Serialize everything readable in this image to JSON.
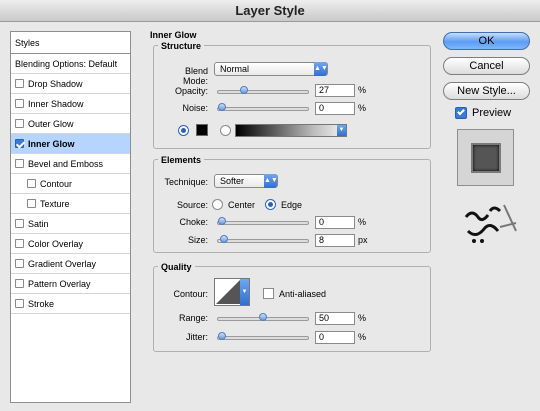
{
  "window": {
    "title": "Layer Style"
  },
  "sidebar": {
    "header": "Styles",
    "items": [
      {
        "label": "Blending Options: Default",
        "checkbox": false,
        "checked": false,
        "selected": false
      },
      {
        "label": "Drop Shadow",
        "checkbox": true,
        "checked": false,
        "selected": false
      },
      {
        "label": "Inner Shadow",
        "checkbox": true,
        "checked": false,
        "selected": false
      },
      {
        "label": "Outer Glow",
        "checkbox": true,
        "checked": false,
        "selected": false
      },
      {
        "label": "Inner Glow",
        "checkbox": true,
        "checked": true,
        "selected": true
      },
      {
        "label": "Bevel and Emboss",
        "checkbox": true,
        "checked": false,
        "selected": false
      },
      {
        "label": "Contour",
        "checkbox": true,
        "checked": false,
        "selected": false
      },
      {
        "label": "Texture",
        "checkbox": true,
        "checked": false,
        "selected": false
      },
      {
        "label": "Satin",
        "checkbox": true,
        "checked": false,
        "selected": false
      },
      {
        "label": "Color Overlay",
        "checkbox": true,
        "checked": false,
        "selected": false
      },
      {
        "label": "Gradient Overlay",
        "checkbox": true,
        "checked": false,
        "selected": false
      },
      {
        "label": "Pattern Overlay",
        "checkbox": true,
        "checked": false,
        "selected": false
      },
      {
        "label": "Stroke",
        "checkbox": true,
        "checked": false,
        "selected": false
      }
    ]
  },
  "inner_glow": {
    "title": "Inner Glow",
    "structure": {
      "title": "Structure",
      "blend_mode_label": "Blend Mode:",
      "blend_mode_value": "Normal",
      "opacity_label": "Opacity:",
      "opacity_value": "27",
      "opacity_unit": "%",
      "opacity_fraction": 0.27,
      "noise_label": "Noise:",
      "noise_value": "0",
      "noise_unit": "%",
      "noise_fraction": 0
    },
    "elements": {
      "title": "Elements",
      "technique_label": "Technique:",
      "technique_value": "Softer",
      "source_label": "Source:",
      "source_center": "Center",
      "source_edge": "Edge",
      "choke_label": "Choke:",
      "choke_value": "0",
      "choke_unit": "%",
      "choke_fraction": 0,
      "size_label": "Size:",
      "size_value": "8",
      "size_unit": "px",
      "size_fraction": 0.03
    },
    "quality": {
      "title": "Quality",
      "contour_label": "Contour:",
      "anti_aliased_label": "Anti-aliased",
      "range_label": "Range:",
      "range_value": "50",
      "range_unit": "%",
      "range_fraction": 0.5,
      "jitter_label": "Jitter:",
      "jitter_value": "0",
      "jitter_unit": "%",
      "jitter_fraction": 0
    }
  },
  "buttons": {
    "ok": "OK",
    "cancel": "Cancel",
    "new_style": "New Style...",
    "preview": "Preview"
  },
  "colors": {
    "selection": "#b5d5ff",
    "accent": "#3a7bd5"
  }
}
